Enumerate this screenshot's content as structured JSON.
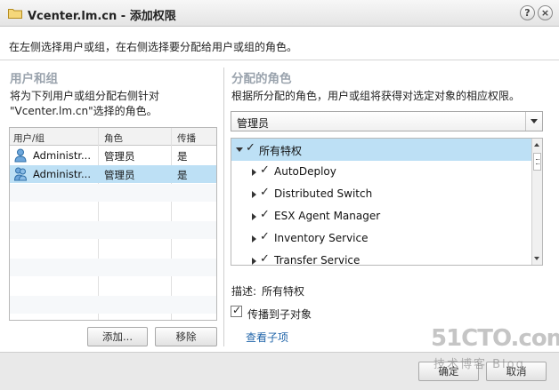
{
  "window": {
    "title": "Vcenter.lm.cn - 添加权限",
    "help": "?",
    "close": "×"
  },
  "instruction": "在左侧选择用户或组，在右侧选择要分配给用户或组的角色。",
  "left": {
    "title": "用户和组",
    "description": "将为下列用户或组分配右侧针对 \"Vcenter.lm.cn\"选择的角色。",
    "columns": [
      "用户/组",
      "角色",
      "传播"
    ],
    "rows": [
      {
        "user": "Administr...",
        "role": "管理员",
        "propagate": "是",
        "icon": "user-icon",
        "selected": false
      },
      {
        "user": "Administr...",
        "role": "管理员",
        "propagate": "是",
        "icon": "group-icon",
        "selected": true
      }
    ],
    "add_label": "添加...",
    "remove_label": "移除"
  },
  "right": {
    "title": "分配的角色",
    "description": "根据所分配的角色，用户或组将获得对选定对象的相应权限。",
    "role_selected": "管理员",
    "tree": [
      {
        "label": "所有特权",
        "expanded": true,
        "checked": true,
        "level": 0,
        "selected": true
      },
      {
        "label": "AutoDeploy",
        "expanded": false,
        "checked": true,
        "level": 1
      },
      {
        "label": "Distributed Switch",
        "expanded": false,
        "checked": true,
        "level": 1
      },
      {
        "label": "ESX Agent Manager",
        "expanded": false,
        "checked": true,
        "level": 1
      },
      {
        "label": "Inventory Service",
        "expanded": false,
        "checked": true,
        "level": 1
      },
      {
        "label": "Transfer Service",
        "expanded": false,
        "checked": true,
        "level": 1
      }
    ],
    "desc_label": "描述:",
    "desc_value": "所有特权",
    "propagate_label": "传播到子对象",
    "propagate_checked": true,
    "view_children": "查看子项"
  },
  "footer": {
    "ok_label": "确定",
    "cancel_label": "取消"
  },
  "watermark": {
    "line1": "51CTO.com",
    "line2": "技术博客 Blog"
  },
  "colors": {
    "selection": "#bde0f5",
    "section_title": "#9aa3ad",
    "link": "#2266aa"
  }
}
